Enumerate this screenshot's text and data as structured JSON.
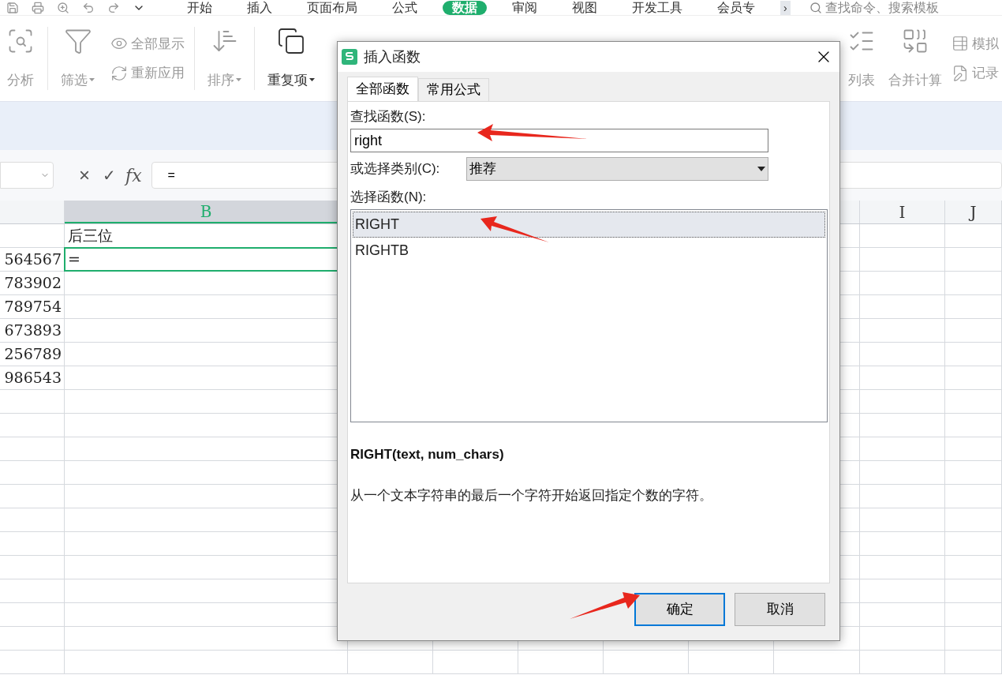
{
  "menu_tabs": [
    {
      "label": "开始",
      "selected": false
    },
    {
      "label": "插入",
      "selected": false
    },
    {
      "label": "页面布局",
      "selected": false
    },
    {
      "label": "公式",
      "selected": false
    },
    {
      "label": "数据",
      "selected": true
    },
    {
      "label": "审阅",
      "selected": false
    },
    {
      "label": "视图",
      "selected": false
    },
    {
      "label": "开发工具",
      "selected": false
    },
    {
      "label": "会员专",
      "selected": false
    }
  ],
  "menu_more": "›",
  "search": {
    "placeholder": "查找命令、搜索模板"
  },
  "ribbon_left": [
    {
      "kind": "large",
      "label": "分析",
      "disabled": true
    },
    {
      "kind": "large",
      "label": "筛选",
      "disabled": true
    },
    {
      "kind": "small",
      "items": [
        {
          "label": "全部显示"
        },
        {
          "label": "重新应用"
        }
      ]
    },
    {
      "kind": "large",
      "label": "排序",
      "disabled": true
    },
    {
      "kind": "large",
      "label": "重复项",
      "disabled": false
    }
  ],
  "ribbon_right": [
    {
      "kind": "large",
      "label": "列表",
      "disabled": true
    },
    {
      "kind": "large",
      "label": "合并计算",
      "disabled": true
    },
    {
      "kind": "small",
      "items": [
        {
          "label": "模拟"
        },
        {
          "label": "记录"
        }
      ]
    }
  ],
  "formula_bar": {
    "cancel": "×",
    "confirm": "✓",
    "fx": "fx",
    "value": "="
  },
  "grid": {
    "columns": [
      {
        "label": "B",
        "selected": true
      },
      {
        "label": "I",
        "selected": false
      },
      {
        "label": "J",
        "selected": false
      }
    ],
    "rows": [
      {
        "b": "后三位",
        "active": false
      },
      {
        "a": "564567",
        "b": "=",
        "active": true
      },
      {
        "a": "783902",
        "active": false
      },
      {
        "a": "789754",
        "active": false
      },
      {
        "a": "673893",
        "active": false
      },
      {
        "a": "256789",
        "active": false
      },
      {
        "a": "986543",
        "active": false
      }
    ]
  },
  "dialog": {
    "title": "插入函数",
    "tabs": [
      {
        "label": "全部函数",
        "selected": true
      },
      {
        "label": "常用公式",
        "selected": false
      }
    ],
    "search_label": "查找函数(S):",
    "search_value": "right",
    "category_label": "或选择类别(C):",
    "category_value": "推荐",
    "list_label": "选择函数(N):",
    "functions": [
      {
        "name": "RIGHT",
        "selected": true
      },
      {
        "name": "RIGHTB",
        "selected": false
      }
    ],
    "signature": "RIGHT(text, num_chars)",
    "description": "从一个文本字符串的最后一个字符开始返回指定个数的字符。",
    "buttons": [
      {
        "label": "确定",
        "kind": "primary"
      },
      {
        "label": "取消",
        "kind": "secondary"
      }
    ]
  }
}
